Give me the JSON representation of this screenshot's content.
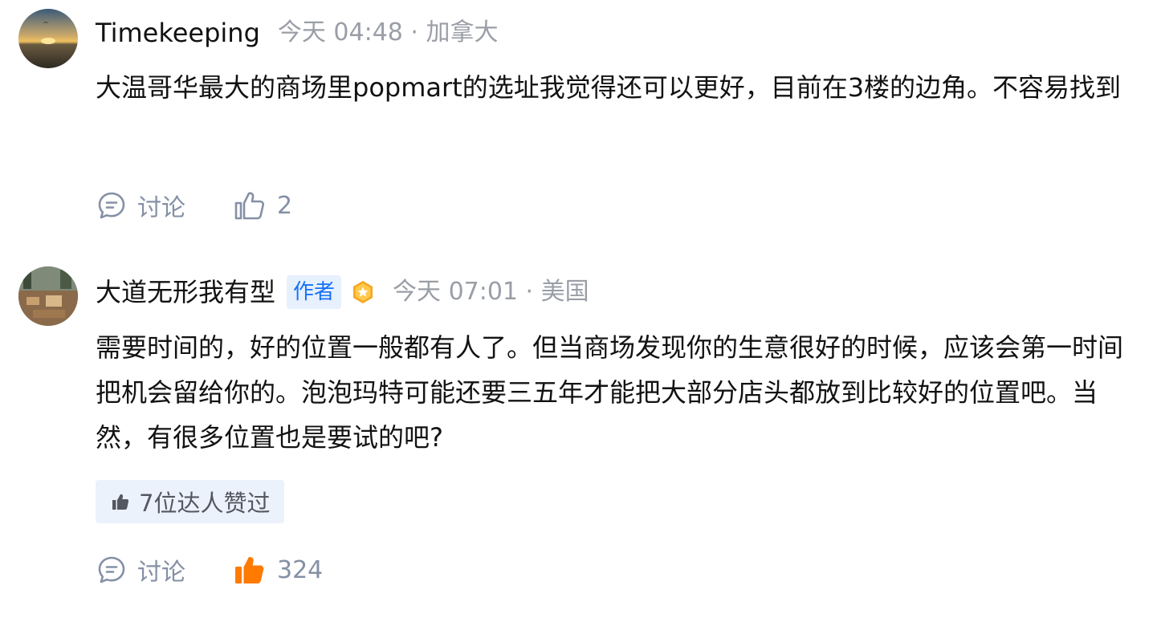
{
  "comments": [
    {
      "author": "Timekeeping",
      "meta": "今天 04:48 · 加拿大",
      "text": "大温哥华最大的商场里popmart的选址我觉得还可以更好，目前在3楼的边角。不容易找到",
      "discuss_label": "讨论",
      "like_count": "2",
      "liked": false
    },
    {
      "author": "大道无形我有型",
      "author_tag": "作者",
      "meta": "今天 07:01 · 美国",
      "text": "需要时间的，好的位置一般都有人了。但当商场发现你的生意很好的时候，应该会第一时间把机会留给你的。泡泡玛特可能还要三五年才能把大部分店头都放到比较好的位置吧。当然，有很多位置也是要试的吧?",
      "expert_likes": "7位达人赞过",
      "discuss_label": "讨论",
      "like_count": "324",
      "liked": true
    }
  ],
  "colors": {
    "text": "#121212",
    "meta": "#9a9ea6",
    "action": "#8590a6",
    "accent_blue": "#1772f6",
    "tag_bg": "#e7f0fd",
    "liked_orange": "#ff7a00",
    "pill_bg": "#ebf2fc"
  },
  "icons": {
    "discuss": "comment-bubble-icon",
    "like": "thumbs-up-icon",
    "liked": "thumbs-up-filled-icon",
    "badge": "gold-star-badge-icon",
    "expert": "small-thumbs-up-icon"
  }
}
